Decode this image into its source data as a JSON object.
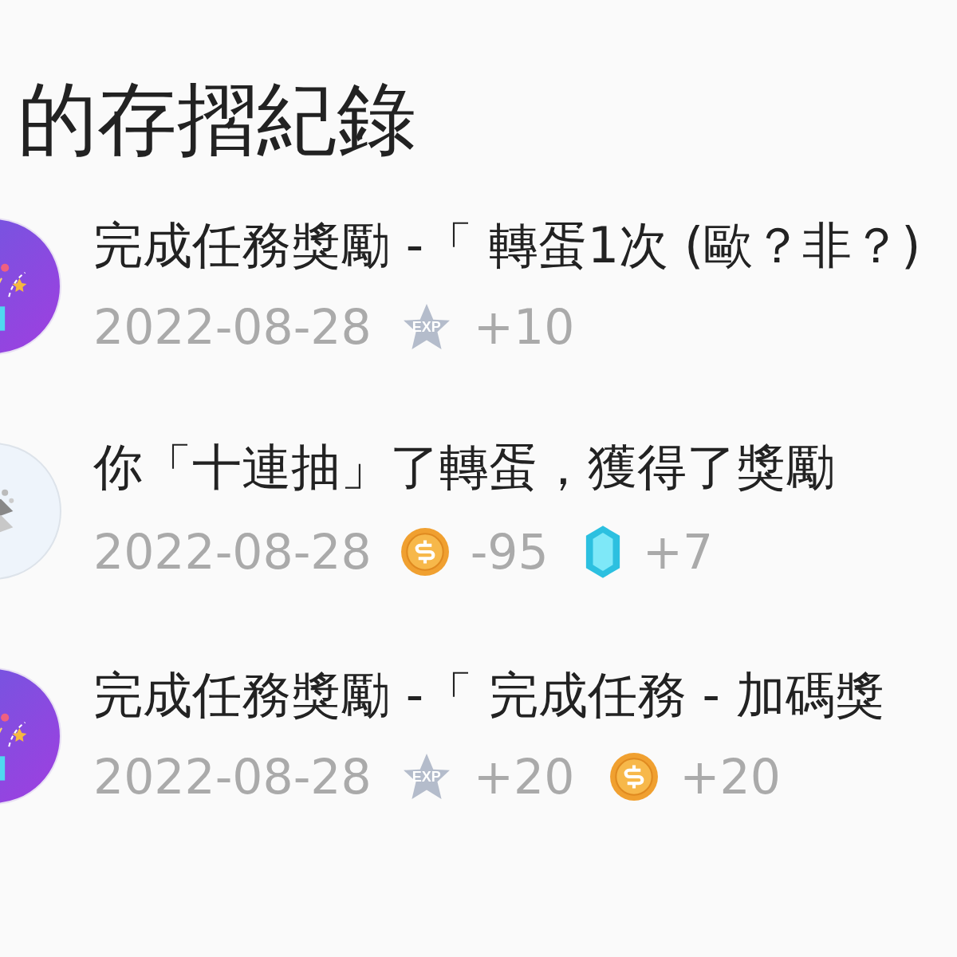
{
  "title": "的存摺紀錄",
  "records": [
    {
      "kind": "quest",
      "text": "完成任務獎勵 -「 轉蛋1次 (歐？非？)",
      "date": "2022-08-28",
      "rewards": [
        {
          "kind": "exp",
          "badge": "EXP",
          "amount": "+10"
        }
      ]
    },
    {
      "kind": "gacha",
      "text": "你「十連抽」了轉蛋，獲得了獎勵",
      "date": "2022-08-28",
      "rewards": [
        {
          "kind": "coin",
          "amount": "-95"
        },
        {
          "kind": "gem",
          "amount": "+7"
        }
      ]
    },
    {
      "kind": "quest",
      "text": "完成任務獎勵 -「 完成任務 - 加碼獎",
      "date": "2022-08-28",
      "rewards": [
        {
          "kind": "exp",
          "badge": "EXP",
          "amount": "+20"
        },
        {
          "kind": "coin",
          "amount": "+20"
        }
      ]
    }
  ]
}
